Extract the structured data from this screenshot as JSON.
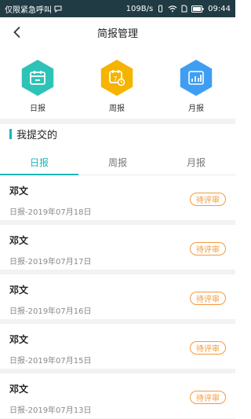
{
  "status_bar": {
    "carrier": "仅限紧急呼叫",
    "speed": "109B/s",
    "time": "09:44"
  },
  "nav": {
    "title": "简报管理"
  },
  "shortcuts": [
    {
      "label": "日报",
      "icon": "calendar-icon",
      "color": "#2fc3b8"
    },
    {
      "label": "周报",
      "icon": "week-calendar-icon",
      "color": "#f5b400"
    },
    {
      "label": "月报",
      "icon": "bar-chart-icon",
      "color": "#3f9ef2"
    }
  ],
  "section": {
    "title": "我提交的"
  },
  "tabs": [
    {
      "label": "日报",
      "active": true
    },
    {
      "label": "周报",
      "active": false
    },
    {
      "label": "月报",
      "active": false
    }
  ],
  "reports": [
    {
      "name": "邓文",
      "date": "日报-2019年07月18日",
      "status": "待评审"
    },
    {
      "name": "邓文",
      "date": "日报-2019年07月17日",
      "status": "待评审"
    },
    {
      "name": "邓文",
      "date": "日报-2019年07月16日",
      "status": "待评审"
    },
    {
      "name": "邓文",
      "date": "日报-2019年07月15日",
      "status": "待评审"
    },
    {
      "name": "邓文",
      "date": "日报-2019年07月13日",
      "status": "待评审"
    }
  ],
  "colors": {
    "accent": "#19b6b6",
    "pending": "#f39a3c",
    "status_bar_bg": "#203b44"
  }
}
